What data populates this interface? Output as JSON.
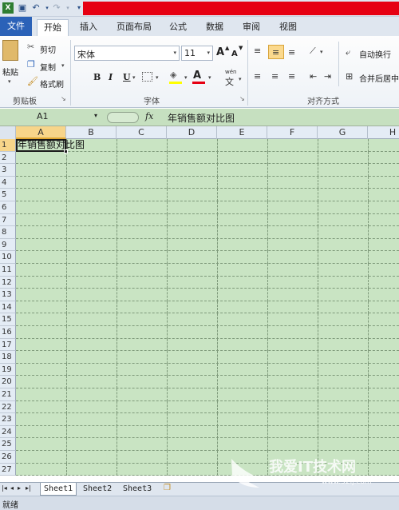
{
  "ribbon": {
    "tabs": {
      "file": "文件",
      "home": "开始",
      "insert": "插入",
      "page_layout": "页面布局",
      "formulas": "公式",
      "data": "数据",
      "review": "审阅",
      "view": "视图"
    },
    "clipboard": {
      "paste": "粘贴",
      "cut": "剪切",
      "copy": "复制",
      "format_painter": "格式刷",
      "group": "剪贴板"
    },
    "font": {
      "name": "宋体",
      "size": "11",
      "bold": "B",
      "italic": "I",
      "underline": "U",
      "group": "字体",
      "grow": "A",
      "shrink": "A",
      "color_letter": "A",
      "phonetic": "wén"
    },
    "alignment": {
      "wrap": "自动换行",
      "merge": "合并后居中",
      "group": "对齐方式"
    }
  },
  "formula_bar": {
    "name_box": "A1",
    "fx": "fx",
    "content": "年销售额对比图"
  },
  "grid": {
    "columns": [
      "A",
      "B",
      "C",
      "D",
      "E",
      "F",
      "G",
      "H"
    ],
    "rows": [
      "1",
      "2",
      "3",
      "4",
      "5",
      "6",
      "7",
      "8",
      "9",
      "10",
      "11",
      "12",
      "13",
      "14",
      "15",
      "16",
      "17",
      "18",
      "19",
      "20",
      "21",
      "22",
      "23",
      "24",
      "25",
      "26",
      "27"
    ],
    "a1_value": "年销售额对比图"
  },
  "sheets": {
    "tab1": "Sheet1",
    "tab2": "Sheet2",
    "tab3": "Sheet3"
  },
  "status": {
    "ready": "就绪"
  },
  "watermark": {
    "text": "我爱IT技术网",
    "url": "www.52ij.com"
  },
  "colors": {
    "accent": "#2b62b8",
    "title_red": "#e60012",
    "grid_bg": "#c9e4c3"
  }
}
